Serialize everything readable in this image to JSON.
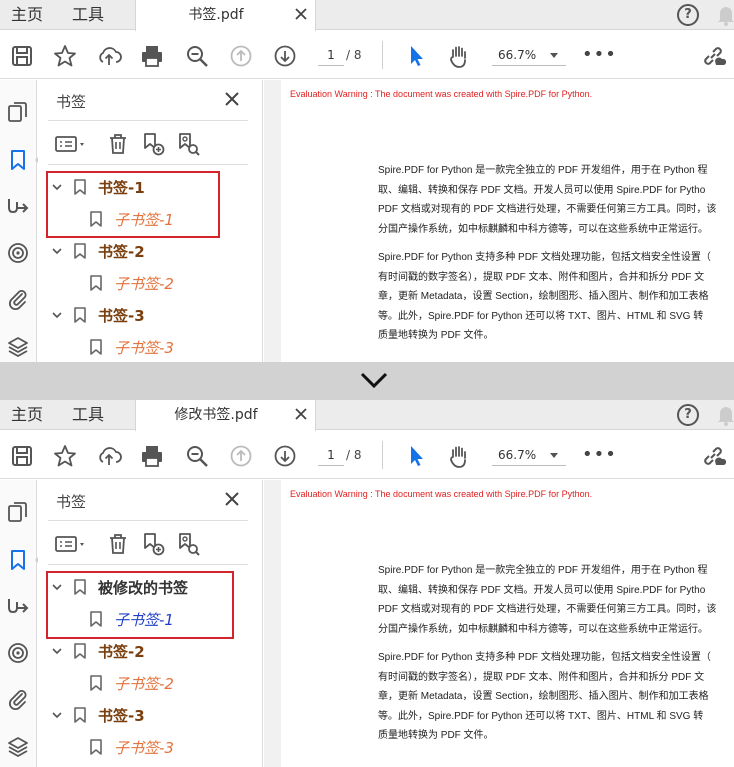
{
  "panes": {
    "top": {
      "tabs": {
        "home": "主页",
        "tools": "工具",
        "doc_title": "书签.pdf"
      },
      "toolbar": {
        "page_current": "1",
        "page_total": "/ 8",
        "zoom": "66.7%"
      },
      "bookmarks_panel": {
        "title": "书签",
        "items": [
          {
            "label": "书签-1",
            "child": "子书签-1"
          },
          {
            "label": "书签-2",
            "child": "子书签-2"
          },
          {
            "label": "书签-3",
            "child": "子书签-3"
          }
        ]
      }
    },
    "bottom": {
      "tabs": {
        "home": "主页",
        "tools": "工具",
        "doc_title": "修改书签.pdf"
      },
      "toolbar": {
        "page_current": "1",
        "page_total": "/ 8",
        "zoom": "66.7%"
      },
      "bookmarks_panel": {
        "title": "书签",
        "items": [
          {
            "label": "被修改的书签",
            "child": "子书签-1"
          },
          {
            "label": "书签-2",
            "child": "子书签-2"
          },
          {
            "label": "书签-3",
            "child": "子书签-3"
          }
        ]
      }
    }
  },
  "document": {
    "eval_warning": "Evaluation Warning : The document was created with Spire.PDF for Python.",
    "para1_lines": [
      "Spire.PDF for Python 是一款完全独立的 PDF 开发组件，用于在 Python 程",
      "取、编辑、转换和保存 PDF 文档。开发人员可以使用 Spire.PDF for Pytho",
      "PDF 文档或对现有的 PDF 文档进行处理，不需要任何第三方工具。同时，该",
      "分国产操作系统，如中标麒麟和中科方德等，可以在这些系统中正常运行。"
    ],
    "para2_lines": [
      "Spire.PDF for Python 支持多种 PDF 文档处理功能，包括文档安全性设置（",
      "有时间戳的数字签名），提取 PDF 文本、附件和图片，合并和拆分 PDF 文",
      "章，更新 Metadata，设置 Section，绘制图形、插入图片、制作和加工表格",
      "等。此外，Spire.PDF for Python 还可以将 TXT、图片、HTML 和 SVG 转",
      "质量地转换为 PDF 文件。"
    ]
  },
  "colors": {
    "parent_bookmark": "#7a3f0e",
    "child_bookmark": "#e3713c",
    "modified_child": "#1e3ec8",
    "highlight": "#d4232b",
    "eval_warning": "#e02020",
    "select_tool_active": "#1473e6"
  },
  "icons": {
    "toolbar": [
      "save-icon",
      "star-icon",
      "cloud-upload-icon",
      "print-icon",
      "zoom-out-icon",
      "page-up-icon",
      "page-down-icon",
      "select-cursor-icon",
      "hand-icon",
      "more-icon",
      "share-link-icon"
    ],
    "rail": [
      "pages-icon",
      "bookmark-icon",
      "signature-icon",
      "layers-target-icon",
      "attachment-icon",
      "layers-icon"
    ],
    "bookmark_tools": [
      "options-icon",
      "delete-bookmark-icon",
      "new-bookmark-icon",
      "find-bookmark-icon"
    ]
  }
}
